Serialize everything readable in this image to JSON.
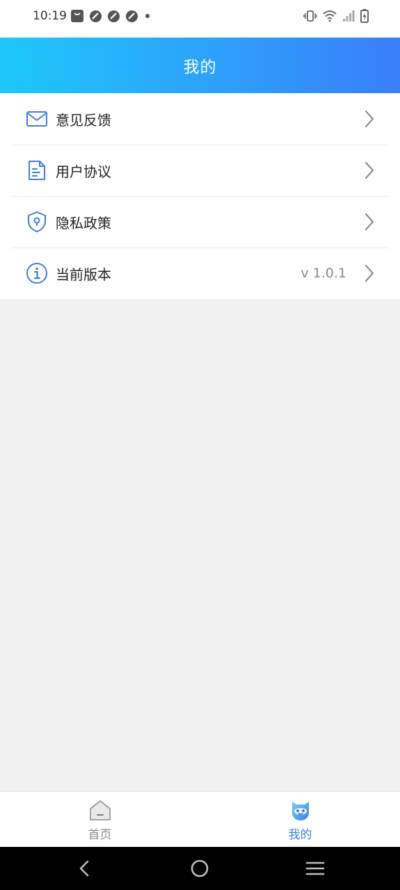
{
  "status_bar": {
    "time": "10:19"
  },
  "header": {
    "title": "我的"
  },
  "menu": {
    "items": [
      {
        "label": "意见反馈",
        "icon": "mail-icon"
      },
      {
        "label": "用户协议",
        "icon": "document-icon"
      },
      {
        "label": "隐私政策",
        "icon": "shield-icon"
      },
      {
        "label": "当前版本",
        "icon": "info-icon",
        "value": "v 1.0.1"
      }
    ]
  },
  "tabbar": {
    "tabs": [
      {
        "label": "首页",
        "icon": "home-icon",
        "active": false
      },
      {
        "label": "我的",
        "icon": "mine-face-icon",
        "active": true
      }
    ],
    "active_color": "#3b82e0",
    "inactive_color": "#8a8a8a"
  },
  "colors": {
    "header_gradient_start": "#1ec8fb",
    "header_gradient_end": "#3a7efb",
    "icon_blue": "#3f7ed8"
  }
}
